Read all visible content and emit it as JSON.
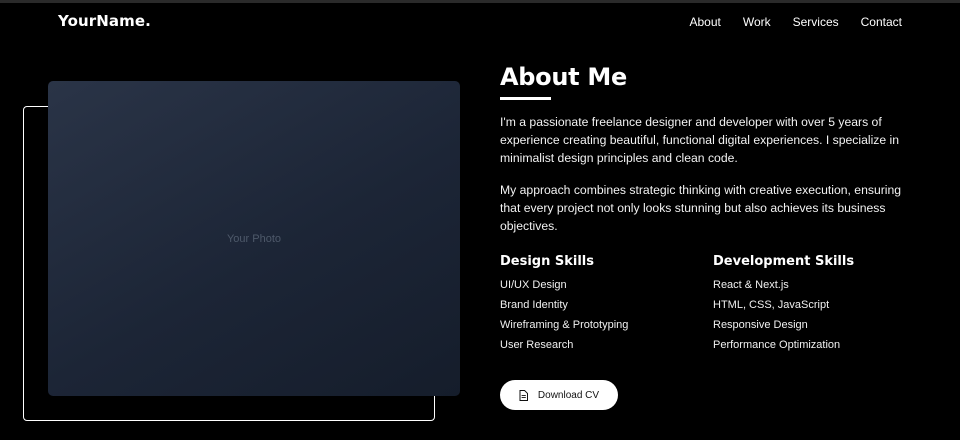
{
  "header": {
    "logo": "YourName.",
    "nav": [
      "About",
      "Work",
      "Services",
      "Contact"
    ]
  },
  "photo": {
    "placeholder": "Your Photo"
  },
  "about": {
    "title": "About Me",
    "paragraphs": [
      "I'm a passionate freelance designer and developer with over 5 years of experience creating beautiful, functional digital experiences. I specialize in minimalist design principles and clean code.",
      "My approach combines strategic thinking with creative execution, ensuring that every project not only looks stunning but also achieves its business objectives."
    ]
  },
  "skills": {
    "design": {
      "title": "Design Skills",
      "items": [
        "UI/UX Design",
        "Brand Identity",
        "Wireframing & Prototyping",
        "User Research"
      ]
    },
    "development": {
      "title": "Development Skills",
      "items": [
        "React & Next.js",
        "HTML, CSS, JavaScript",
        "Responsive Design",
        "Performance Optimization"
      ]
    }
  },
  "cta": {
    "download_label": "Download CV",
    "icon": "document-icon"
  },
  "colors": {
    "background": "#000000",
    "text": "#ffffff",
    "photo": "#1c2536"
  }
}
